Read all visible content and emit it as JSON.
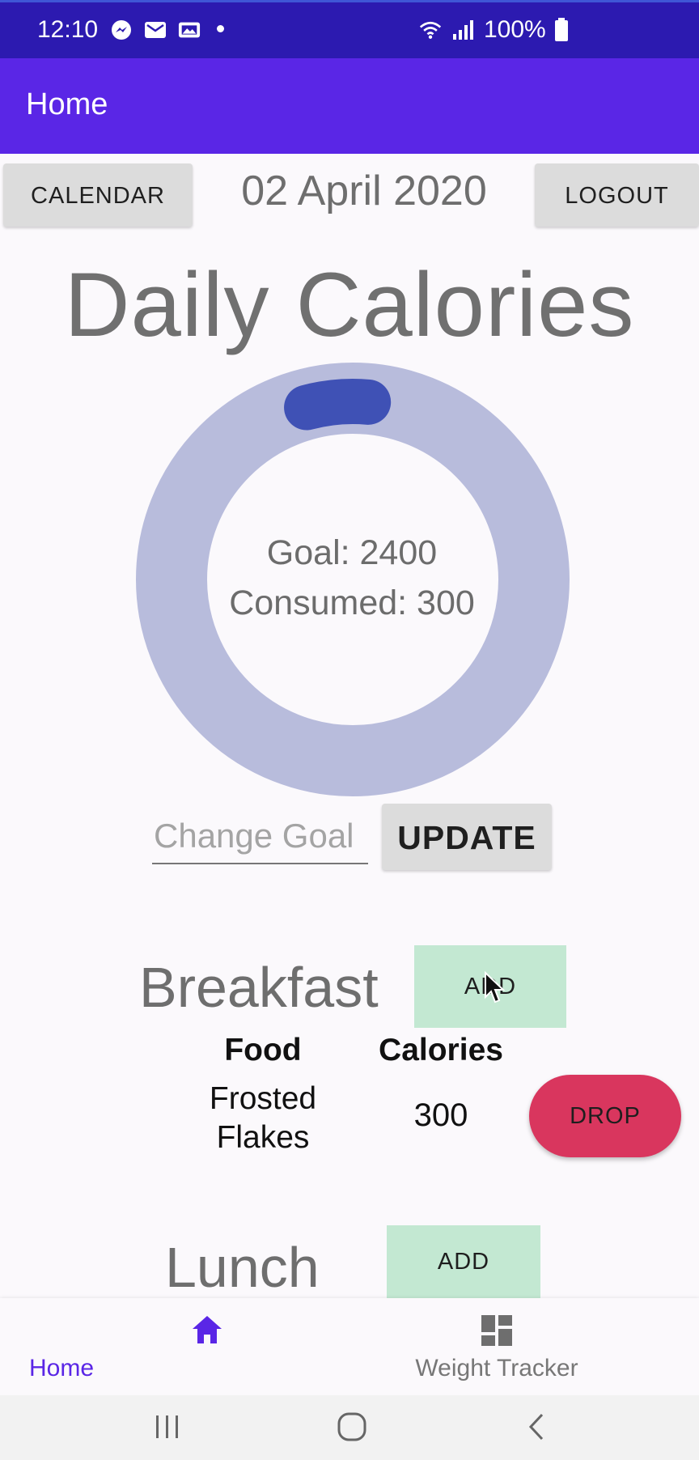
{
  "status_bar": {
    "time": "12:10",
    "battery": "100%"
  },
  "app_bar": {
    "title": "Home"
  },
  "header": {
    "calendar_label": "CALENDAR",
    "date": "02 April 2020",
    "logout_label": "LOGOUT"
  },
  "daily": {
    "title": "Daily Calories",
    "goal_text": "Goal: 2400",
    "consumed_text": "Consumed: 300",
    "consumed_fraction": 0.125
  },
  "goal_form": {
    "placeholder": "Change Goal",
    "update_label": "UPDATE"
  },
  "breakfast": {
    "title": "Breakfast",
    "add_label": "ADD",
    "columns": [
      "Food",
      "Calories"
    ],
    "items": [
      {
        "food": "Frosted Flakes",
        "calories": "300",
        "drop_label": "DROP"
      }
    ]
  },
  "lunch": {
    "title": "Lunch",
    "add_label": "ADD"
  },
  "bottom_nav": [
    {
      "label": "Home",
      "icon": "home-icon",
      "active": true
    },
    {
      "label": "Weight Tracker",
      "icon": "dashboard-icon",
      "active": false
    }
  ],
  "colors": {
    "status_bar": "#2c1ab0",
    "app_bar": "#5a26e6",
    "ring_track": "#b8bcdc",
    "ring_progress": "#3f51b5",
    "add_button": "#c3e8d2",
    "drop_button": "#d9365e",
    "nav_active": "#5a26e6"
  }
}
